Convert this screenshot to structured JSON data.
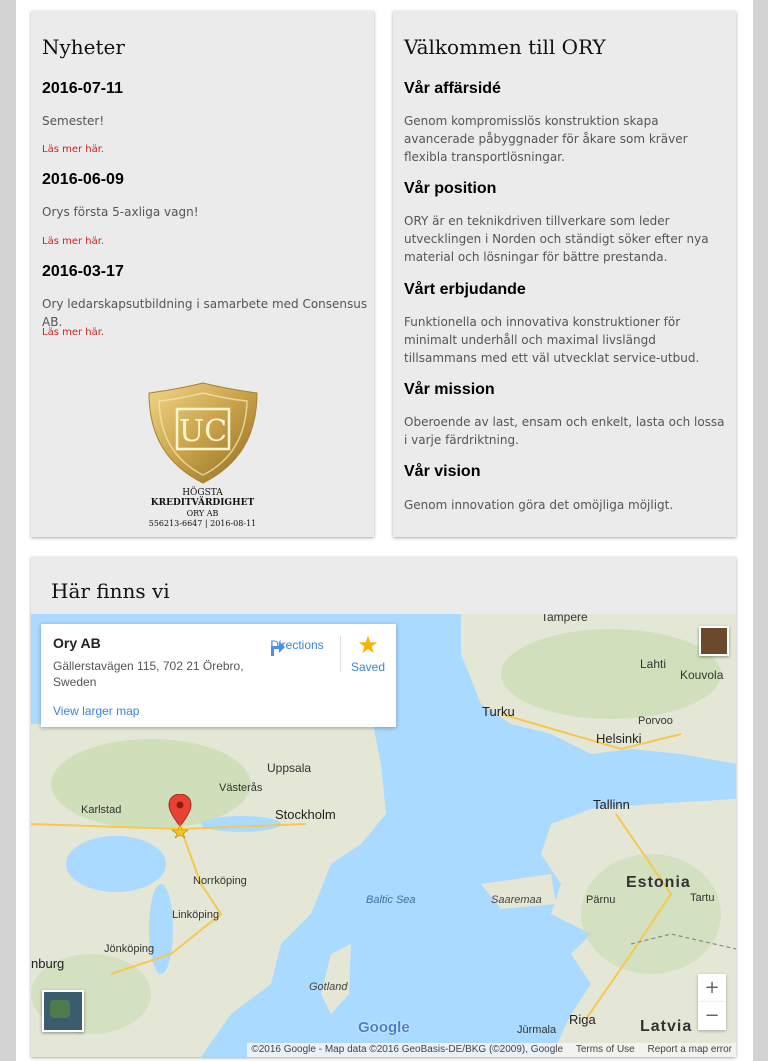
{
  "news": {
    "title": "Nyheter",
    "items": [
      {
        "date": "2016-07-11",
        "text": "Semester!",
        "link": "Läs mer här."
      },
      {
        "date": "2016-06-09",
        "text": "Orys första 5-axliga vagn!",
        "link": "Läs mer här."
      },
      {
        "date": "2016-03-17",
        "text": "Ory ledarskapsutbildning i samarbete med Consensus AB.",
        "link": "Läs mer här."
      }
    ],
    "badge": {
      "logo": "UC",
      "line1": "HÖGSTA",
      "line2": "KREDITVÄRDIGHET",
      "line3": "ORY AB",
      "line4": "556213-6647 | 2016-08-11"
    }
  },
  "welcome": {
    "title": "Välkommen till ORY",
    "sections": [
      {
        "heading": "Vår affärsidé",
        "text": "Genom kompromisslös konstruktion skapa avancerade påbyggnader för åkare som kräver flexibla transportlösningar."
      },
      {
        "heading": "Vår position",
        "text": "ORY är en teknikdriven tillverkare som leder utvecklingen i Norden och ständigt söker efter nya material och lösningar för bättre prestanda."
      },
      {
        "heading": "Vårt erbjudande",
        "text": "Funktionella och innovativa konstruktioner för minimalt underhåll och maximal livslängd tillsammans med ett väl utvecklat service-utbud."
      },
      {
        "heading": "Vår mission",
        "text": "Oberoende av last, ensam och enkelt, lasta och lossa i varje färdriktning."
      },
      {
        "heading": "Vår vision",
        "text": "Genom innovation göra det omöjliga möjligt."
      }
    ]
  },
  "location": {
    "title": "Här finns vi",
    "card": {
      "name": "Ory AB",
      "address": "Gällerstavägen 115, 702 21 Örebro, Sweden",
      "directions": "Directions",
      "saved": "Saved",
      "larger_map": "View larger map"
    },
    "map_labels": {
      "tampere": "Tampere",
      "lahti": "Lahti",
      "kouvola": "Kouvola",
      "turku": "Turku",
      "porvoo": "Porvoo",
      "helsinki": "Helsinki",
      "uppsala": "Uppsala",
      "vasteras": "Västerås",
      "karlstad": "Karlstad",
      "stockholm": "Stockholm",
      "tallinn": "Tallinn",
      "estonia": "Estonia",
      "norrkoping": "Norrköping",
      "linkoping": "Linköping",
      "baltic": "Baltic Sea",
      "saaremaa": "Saaremaa",
      "parnu": "Pärnu",
      "tartu": "Tartu",
      "jonkoping": "Jönköping",
      "goteborg": "nburg",
      "gotland": "Gotland",
      "riga": "Riga",
      "jurmala": "Jūrmala",
      "latvia": "Latvia"
    },
    "google": "Google",
    "attribution": "©2016 Google - Map data ©2016 GeoBasis-DE/BKG (©2009), Google",
    "terms": "Terms of Use",
    "report": "Report a map error",
    "zoom_in": "+",
    "zoom_out": "−"
  },
  "colors": {
    "panel_bg": "#ebebeb",
    "link_red": "#d21f1f",
    "map_water": "#aadaff",
    "map_land": "#e8e4d8",
    "map_green": "#c8dfa8",
    "gold": "#c9a24a",
    "google_blue": "#3a84df"
  }
}
